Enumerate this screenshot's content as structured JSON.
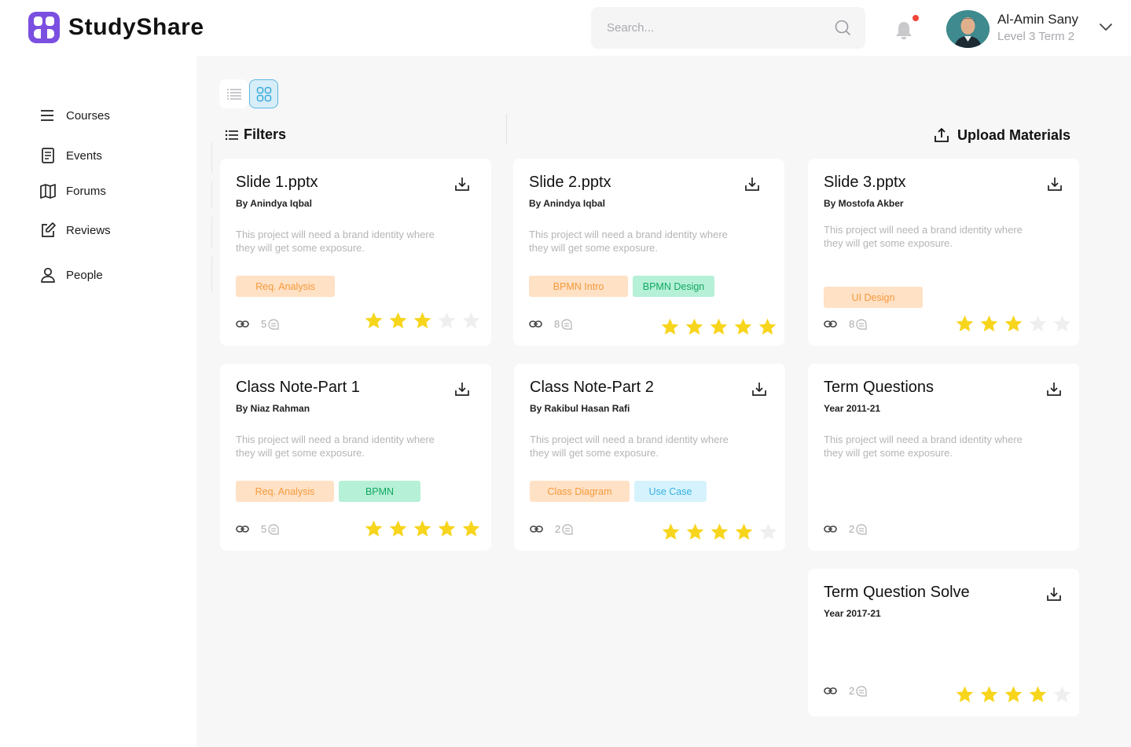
{
  "app": {
    "brand": "StudyShare"
  },
  "header": {
    "search_placeholder": "Search...",
    "user": {
      "name": "Al-Amin Sany",
      "level": "Level 3 Term 2"
    }
  },
  "sidebar": {
    "items": [
      {
        "label": "Courses",
        "icon": "menu-icon"
      },
      {
        "label": "Events",
        "icon": "document-icon"
      },
      {
        "label": "Forums",
        "icon": "map-icon"
      },
      {
        "label": "Reviews",
        "icon": "edit-icon"
      },
      {
        "label": "People",
        "icon": "person-icon"
      }
    ]
  },
  "toolbar": {
    "filters_label": "Filters",
    "upload_label": "Upload Materials",
    "active_view": "grid"
  },
  "colors": {
    "accent": "#7b4fe0",
    "star": "#f7d51d",
    "star_empty": "#efefef"
  },
  "cards": [
    {
      "title": "Slide 1.pptx",
      "author": "By Anindya Iqbal",
      "desc": "This project will need a brand identity where they will get some exposure.",
      "tags": [
        {
          "label": "Req. Analysis",
          "style": "orange"
        }
      ],
      "links": "5",
      "rating": 3
    },
    {
      "title": "Slide 2.pptx",
      "author": "By Anindya Iqbal",
      "desc": "This project will need a brand identity where they will get some exposure.",
      "tags": [
        {
          "label": "BPMN Intro",
          "style": "orange"
        },
        {
          "label": "BPMN Design",
          "style": "green"
        }
      ],
      "links": "8",
      "rating": 5
    },
    {
      "title": "Slide 3.pptx",
      "author": "By Mostofa Akber",
      "desc": "This project will need a brand identity where they will get some exposure.",
      "tags": [
        {
          "label": "UI Design",
          "style": "orange"
        }
      ],
      "links": "8",
      "rating": 3
    },
    {
      "title": "Class Note-Part 1",
      "author": "By Niaz Rahman",
      "desc": "This project will need a brand identity where they will get some exposure.",
      "tags": [
        {
          "label": "Req. Analysis",
          "style": "orange"
        },
        {
          "label": "BPMN",
          "style": "green"
        }
      ],
      "links": "5",
      "rating": 5
    },
    {
      "title": "Class Note-Part 2",
      "author": "By Rakibul Hasan Rafi",
      "desc": "This project will need a brand identity where they will get some exposure.",
      "tags": [
        {
          "label": "Class Diagram",
          "style": "orange"
        },
        {
          "label": "Use Case",
          "style": "blue"
        }
      ],
      "links": "2",
      "rating": 4
    },
    {
      "title": "Term Questions",
      "author": "Year 2011-21",
      "desc": "This project will need a brand identity where they will get some exposure.",
      "tags": [],
      "links": "2",
      "rating": null
    },
    {
      "title": "Term Question Solve",
      "author": "Year 2017-21",
      "desc": "",
      "tags": [],
      "links": "2",
      "rating": 4
    }
  ]
}
